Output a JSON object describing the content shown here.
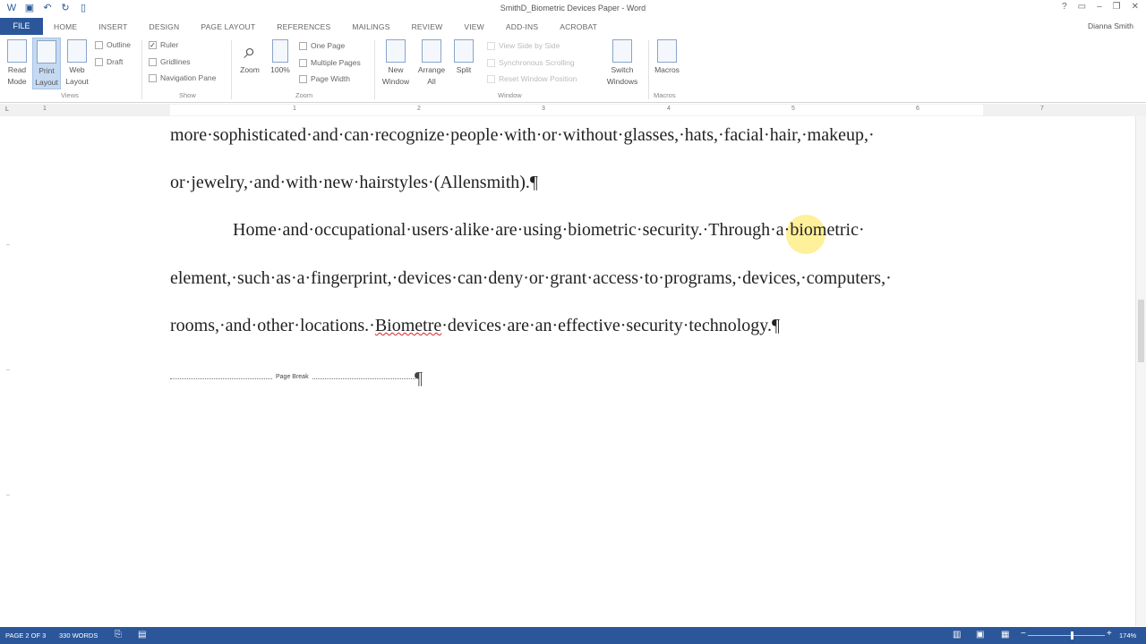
{
  "window": {
    "title": "SmithD_Biometric Devices Paper - Word",
    "user": "Dianna Smith"
  },
  "tabs": [
    "FILE",
    "HOME",
    "INSERT",
    "DESIGN",
    "PAGE LAYOUT",
    "REFERENCES",
    "MAILINGS",
    "REVIEW",
    "VIEW",
    "ADD-INS",
    "ACROBAT"
  ],
  "ribbon": {
    "views": {
      "read_mode": "Read Mode",
      "print_layout": "Print Layout",
      "web_layout": "Web Layout",
      "outline": "Outline",
      "draft": "Draft",
      "group": "Views"
    },
    "show": {
      "ruler": "Ruler",
      "gridlines": "Gridlines",
      "navigation_pane": "Navigation Pane",
      "group": "Show"
    },
    "zoom": {
      "zoom": "Zoom",
      "pct": "100%",
      "one_page": "One Page",
      "multiple_pages": "Multiple Pages",
      "page_width": "Page Width",
      "group": "Zoom"
    },
    "window": {
      "new_window": "New Window",
      "arrange_all": "Arrange All",
      "split": "Split",
      "view_side": "View Side by Side",
      "sync_scroll": "Synchronous Scrolling",
      "reset_pos": "Reset Window Position",
      "switch_windows": "Switch Windows",
      "group": "Window"
    },
    "macros": {
      "label": "Macros",
      "group": "Macros"
    }
  },
  "ruler": {
    "numbers": [
      "1",
      "1",
      "2",
      "3",
      "4",
      "5",
      "6",
      "7"
    ]
  },
  "document": {
    "line1": "more·sophisticated·and·can·recognize·people·with·or·without·glasses,·hats,·facial·hair,·makeup,·",
    "line2": "or·jewelry,·and·with·new·hairstyles·(Allensmith).¶",
    "line3": "Home·and·occupational·users·alike·are·using·biometric·security.·Through·a·biometric·",
    "line4": "element,·such·as·a·fingerprint,·devices·can·deny·or·grant·access·to·programs,·devices,·computers,·",
    "line5_a": "rooms,·and·other·locations.·",
    "line5_b": "Biometre",
    "line5_c": "·devices·are·an·effective·security·technology.¶",
    "page_break": "Page Break",
    "pilcrow": "¶"
  },
  "status": {
    "page": "PAGE 2 OF 3",
    "words": "330 WORDS",
    "zoom": "174%"
  },
  "colors": {
    "accent": "#2b579a"
  }
}
